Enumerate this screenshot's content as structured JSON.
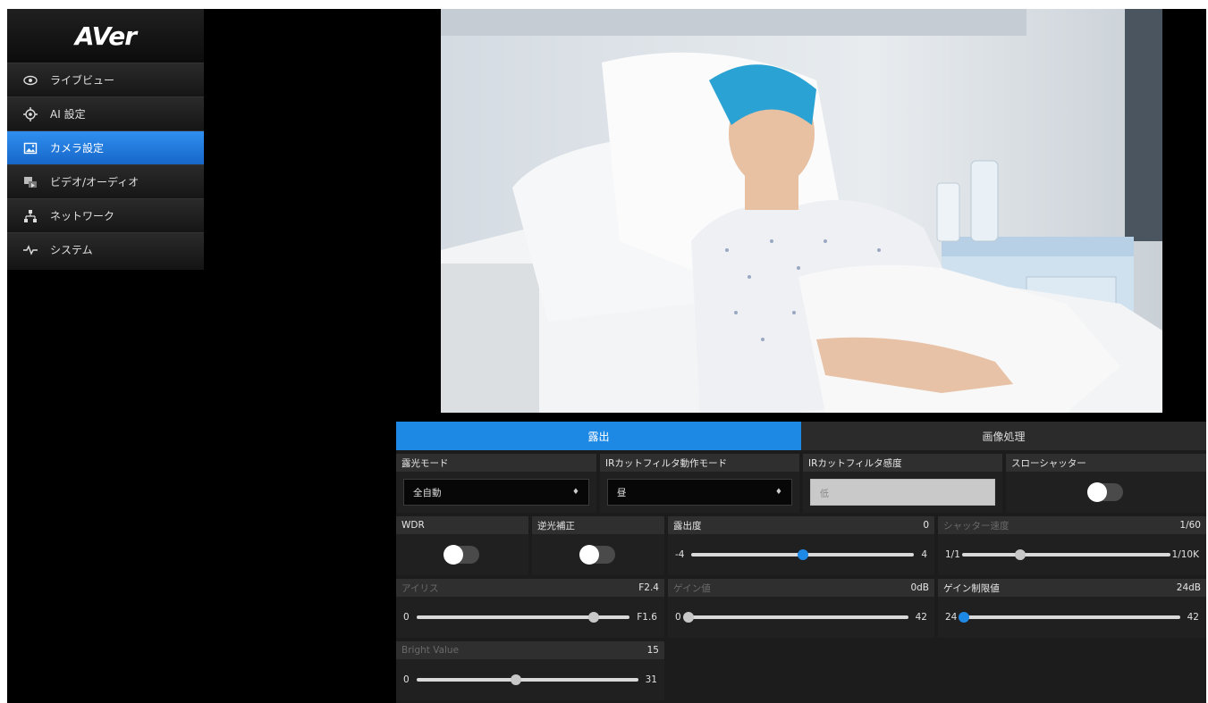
{
  "brand": {
    "logo_text": "AVer"
  },
  "sidebar": {
    "items": [
      {
        "label": "ライブビュー",
        "icon": "eye-icon",
        "active": false
      },
      {
        "label": "AI 設定",
        "icon": "target-icon",
        "active": false
      },
      {
        "label": "カメラ設定",
        "icon": "image-icon",
        "active": true
      },
      {
        "label": "ビデオ/オーディオ",
        "icon": "video-audio-icon",
        "active": false
      },
      {
        "label": "ネットワーク",
        "icon": "network-icon",
        "active": false
      },
      {
        "label": "システム",
        "icon": "pulse-icon",
        "active": false
      }
    ]
  },
  "tabs": [
    {
      "label": "露出",
      "active": true
    },
    {
      "label": "画像処理",
      "active": false
    }
  ],
  "exposure": {
    "exposure_mode": {
      "label": "露光モード",
      "value": "全自動"
    },
    "ir_mode": {
      "label": "IRカットフィルタ動作モード",
      "value": "昼"
    },
    "ir_sensitivity": {
      "label": "IRカットフィルタ感度",
      "value": "低"
    },
    "slow_shutter": {
      "label": "スローシャッター",
      "enabled": false
    },
    "wdr": {
      "label": "WDR",
      "enabled": false
    },
    "backlight": {
      "label": "逆光補正",
      "enabled": false
    },
    "exposure_level": {
      "label": "露出度",
      "value": "0",
      "min": "-4",
      "max": "4",
      "fraction": 0.5
    },
    "shutter_speed": {
      "label": "シャッター速度",
      "value": "1/60",
      "min": "1/1",
      "max": "1/10K",
      "fraction": 0.28
    },
    "iris": {
      "label": "アイリス",
      "value": "F2.4",
      "min": "0",
      "max": "F1.6",
      "fraction": 0.83
    },
    "gain": {
      "label": "ゲイン値",
      "value": "0dB",
      "min": "0",
      "max": "42",
      "fraction": 0.0
    },
    "gain_limit": {
      "label": "ゲイン制限値",
      "value": "24dB",
      "min": "24",
      "max": "42",
      "fraction": 0.0
    },
    "bright_value": {
      "label": "Bright Value",
      "value": "15",
      "min": "0",
      "max": "31",
      "fraction": 0.45
    }
  },
  "colors": {
    "accent": "#1e88e5",
    "panel": "#1c1c1c",
    "background": "#000000"
  }
}
